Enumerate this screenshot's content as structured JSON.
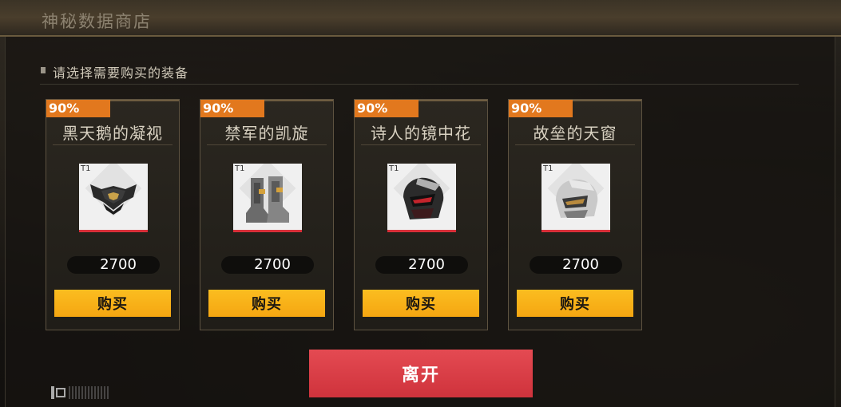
{
  "shop": {
    "title": "神秘数据商店",
    "section_label": "请选择需要购买的装备",
    "leave_label": "离开"
  },
  "items": [
    {
      "discount": "90%",
      "name": "黑天鹅的凝视",
      "tier": "T1",
      "price": "2700",
      "buy_label": "购买",
      "icon": "helmet-black-icon"
    },
    {
      "discount": "90%",
      "name": "禁军的凯旋",
      "tier": "T1",
      "price": "2700",
      "buy_label": "购买",
      "icon": "boots-grey-icon"
    },
    {
      "discount": "90%",
      "name": "诗人的镜中花",
      "tier": "T1",
      "price": "2700",
      "buy_label": "购买",
      "icon": "helmet-red-visor-icon"
    },
    {
      "discount": "90%",
      "name": "故垒的天窗",
      "tier": "T1",
      "price": "2700",
      "buy_label": "购买",
      "icon": "helmet-white-icon"
    }
  ],
  "colors": {
    "discount": "#e2781e",
    "buy_button": "#f5a611",
    "leave_button": "#d63a42",
    "rarity_bar": "#d9303a"
  }
}
